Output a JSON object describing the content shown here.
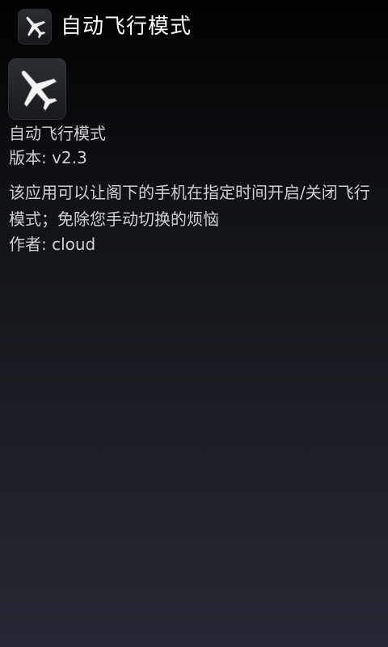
{
  "action_bar": {
    "title": "自动飞行模式",
    "icon": "airplane-icon"
  },
  "about": {
    "icon": "airplane-icon",
    "app_name": "自动飞行模式",
    "version_line": "版本: v2.3",
    "description": "该应用可以让阁下的手机在指定时间开启/关闭飞行模式；免除您手动切换的烦恼",
    "author_line": "作者: cloud"
  },
  "colors": {
    "background_top": "#000000",
    "background_bottom": "#242832",
    "title_text": "#ffffff",
    "body_text": "#cfd0d2"
  }
}
